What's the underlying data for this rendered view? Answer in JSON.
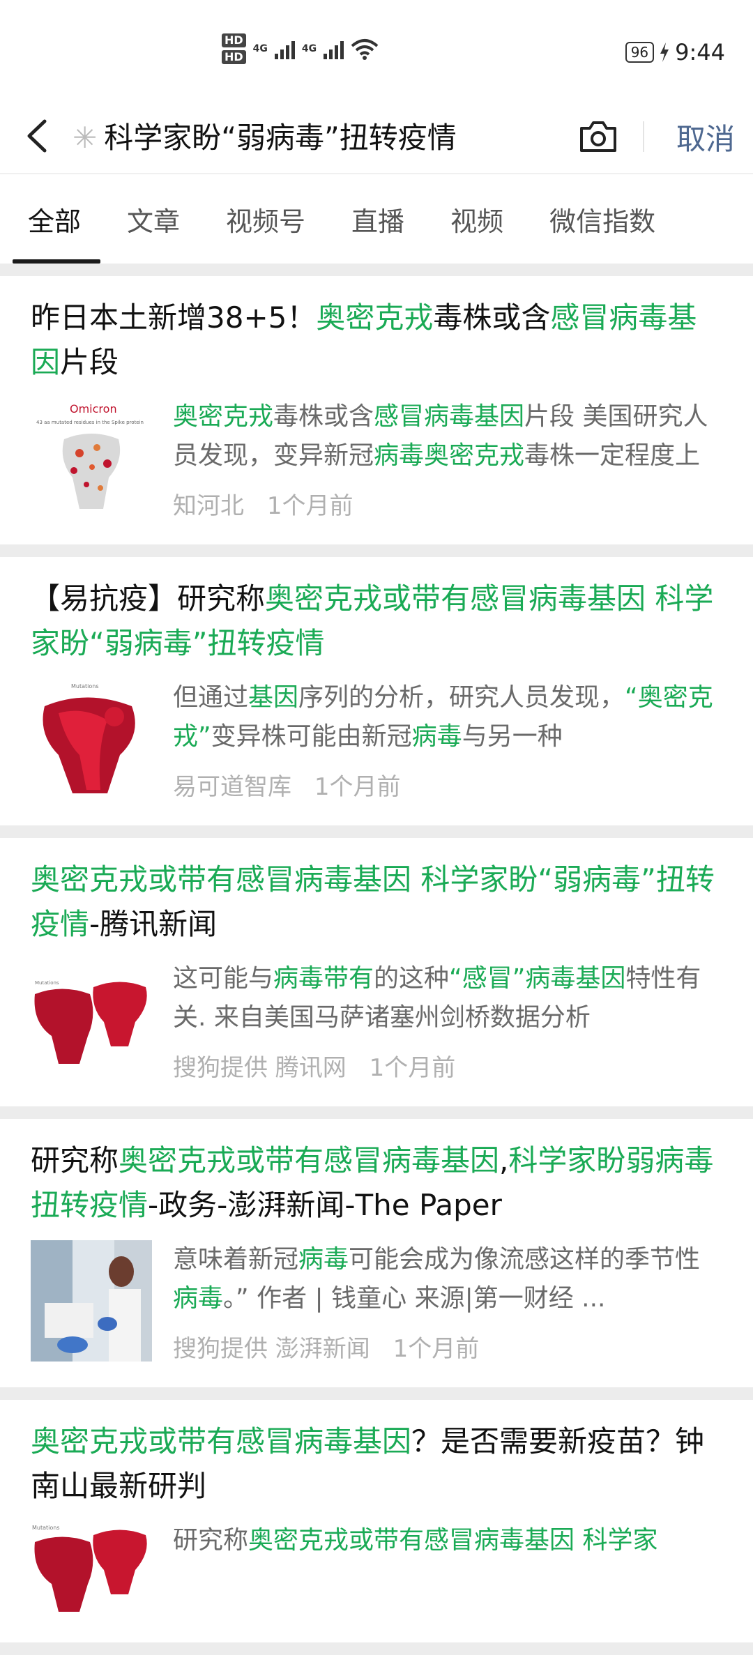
{
  "statusbar": {
    "hd1": "HD",
    "hd2": "HD",
    "net1": "4G",
    "net2": "4G",
    "battery": "96",
    "time": "9:44"
  },
  "search": {
    "loader_glyph": "✳",
    "query": "科学家盼“弱病毒”扭转疫情",
    "cancel_label": "取消"
  },
  "tabs": [
    {
      "label": "全部",
      "active": true
    },
    {
      "label": "文章"
    },
    {
      "label": "视频号"
    },
    {
      "label": "直播"
    },
    {
      "label": "视频"
    },
    {
      "label": "微信指数"
    }
  ],
  "results": [
    {
      "title": [
        [
          "昨日本土新增38+5！",
          false
        ],
        [
          "奥密克戎",
          true
        ],
        [
          "毒株或含",
          false
        ],
        [
          "感冒病毒基因",
          true
        ],
        [
          "片段",
          false
        ]
      ],
      "snippet": [
        [
          "奥密克戎",
          true
        ],
        [
          "毒株或含",
          false
        ],
        [
          "感冒病毒基因",
          true
        ],
        [
          "片段 美国研究人员发现，变异新冠",
          false
        ],
        [
          "病毒奥密克戎",
          true
        ],
        [
          "毒株一定程度上",
          false
        ]
      ],
      "source": "知河北",
      "time": "1个月前",
      "thumb_label": "Omicron",
      "thumb_caption": "43 aa mutated residues in the Spike protein"
    },
    {
      "title": [
        [
          "【易抗疫】研究称",
          false
        ],
        [
          "奥密克戎或带有感冒病毒基因 科学家盼“弱病毒”扭转疫情",
          true
        ]
      ],
      "snippet": [
        [
          "但通过",
          false
        ],
        [
          "基因",
          true
        ],
        [
          "序列的分析，研究人员发现，",
          false
        ],
        [
          "“奥密克戎”",
          true
        ],
        [
          "变异株可能由新冠",
          false
        ],
        [
          "病毒",
          true
        ],
        [
          "与另一种",
          false
        ]
      ],
      "source": "易可道智库",
      "time": "1个月前",
      "thumb_label": "Mutations"
    },
    {
      "title": [
        [
          "奥密克戎或带有感冒病毒基因 科学家盼“弱病毒”扭转疫情",
          true
        ],
        [
          "-腾讯新闻",
          false
        ]
      ],
      "snippet": [
        [
          "这可能与",
          false
        ],
        [
          "病毒带有",
          true
        ],
        [
          "的这种",
          false
        ],
        [
          "“感冒”病毒基因",
          true
        ],
        [
          "特性有关. 来自美国马萨诸塞州剑桥数据分析",
          false
        ]
      ],
      "source": "搜狗提供 腾讯网",
      "time": "1个月前",
      "thumb_label": "Mutations"
    },
    {
      "title": [
        [
          "研究称",
          false
        ],
        [
          "奥密克戎或带有感冒病毒基因",
          true
        ],
        [
          ",",
          false
        ],
        [
          "科学家盼弱病毒扭转疫情",
          true
        ],
        [
          "-政务-澎湃新闻-The Paper",
          false
        ]
      ],
      "snippet": [
        [
          "意味着新冠",
          false
        ],
        [
          "病毒",
          true
        ],
        [
          "可能会成为像流感这样的季节性",
          false
        ],
        [
          "病毒",
          true
        ],
        [
          "。” 作者 | 钱童心 来源|第一财经 ...",
          false
        ]
      ],
      "source": "搜狗提供 澎湃新闻",
      "time": "1个月前",
      "thumb_label": ""
    },
    {
      "title": [
        [
          "奥密克戎或带有感冒病毒基因",
          true
        ],
        [
          "？是否需要新疫苗？钟南山最新研判",
          false
        ]
      ],
      "snippet": [
        [
          "研究称",
          false
        ],
        [
          "奥密克戎或带有感冒病毒基因 科学家",
          true
        ]
      ],
      "source": "",
      "time": "",
      "thumb_label": "Mutations"
    }
  ],
  "colors": {
    "highlight": "#1aaa55",
    "cancel": "#4e6890",
    "meta": "#b0b0b0",
    "virus_red": "#c0142e"
  }
}
